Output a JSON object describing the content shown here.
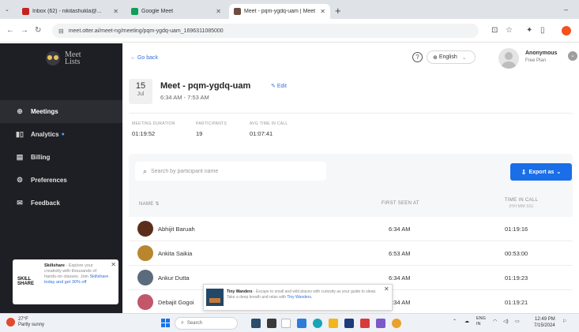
{
  "browser": {
    "tabs": [
      {
        "title": "Inbox (62) - nikitashukla@...",
        "favicon_color": "#c5221f",
        "active": false
      },
      {
        "title": "Google Meet",
        "favicon_color": "#0f9d58",
        "active": false
      },
      {
        "title": "Meet - pqm-ygdq-uam | Meet",
        "favicon_color": "#6d4c41",
        "active": true
      }
    ],
    "url": "meet.otter.ai/meet-ng/meeting/pqm-ygdq-uam_1696311085000"
  },
  "sidebar": {
    "logo_line1": "Meet",
    "logo_line2": "Lists",
    "items": [
      {
        "label": "Meetings",
        "icon": "meetings-icon",
        "glyph": "⊕",
        "active": true,
        "dot": ""
      },
      {
        "label": "Analytics",
        "icon": "analytics-icon",
        "glyph": "▮▯",
        "active": false,
        "dot": "●"
      },
      {
        "label": "Billing",
        "icon": "billing-icon",
        "glyph": "▤",
        "active": false,
        "dot": ""
      },
      {
        "label": "Preferences",
        "icon": "preferences-icon",
        "glyph": "⚙",
        "active": false,
        "dot": ""
      },
      {
        "label": "Feedback",
        "icon": "feedback-icon",
        "glyph": "✉",
        "active": false,
        "dot": ""
      }
    ],
    "promo": {
      "brand_line1": "SKILL",
      "brand_line2": "SHARE",
      "title": "Skillshare",
      "text": "- Explore your creativity with thousands of hands-on classes. Join",
      "link": "Skillshare today and get 30% off"
    }
  },
  "header": {
    "go_back": "← Go back",
    "help": "?",
    "language": "English",
    "language_prefix": "⊕",
    "user_name": "Anonymous",
    "user_plan": "Free Plan"
  },
  "meeting": {
    "day": "15",
    "month": "Jul",
    "title": "Meet - pqm-ygdq-uam",
    "time_range": "6:34 AM - 7:53 AM",
    "edit_label": "Edit",
    "stats": [
      {
        "label": "MEETING DURATION",
        "value": "01:19:52"
      },
      {
        "label": "PARTICIPANTS",
        "value": "19"
      },
      {
        "label": "AVG TIME IN CALL",
        "value": "01:07:41"
      }
    ]
  },
  "participants": {
    "search_placeholder": "Search by participant name",
    "export_label": "Export as",
    "columns": {
      "name": "NAME",
      "first_seen": "FIRST SEEN AT",
      "time_in_call": "TIME IN CALL",
      "time_in_call_unit": "(HH:MM:SS)"
    },
    "rows": [
      {
        "name": "Abhijit Baruah",
        "first_seen": "6:34 AM",
        "time": "01:19:16",
        "avatar_color": "#5a2e1b"
      },
      {
        "name": "Ankita Saikia",
        "first_seen": "6:53 AM",
        "time": "00:53:00",
        "avatar_color": "#b8862f"
      },
      {
        "name": "Ankur Dutta",
        "first_seen": "6:34 AM",
        "time": "01:19:23",
        "avatar_color": "#5b6b7d"
      },
      {
        "name": "Debajit Gogoi",
        "first_seen": "6:34 AM",
        "time": "01:19:21",
        "avatar_color": "#c2566a"
      }
    ]
  },
  "toast": {
    "title": "Tiny Wanders",
    "text": "- Escape to small and wild places with curiosity as your guide to sleep. Take a deep breath and relax with",
    "link": "Tiny Wanders."
  },
  "taskbar": {
    "weather_temp": "27°F",
    "weather_desc": "Partly sunny",
    "search_label": "Search",
    "lang": "ENG",
    "lang_sub": "IN",
    "time": "12:49 PM",
    "date": "7/15/2024"
  }
}
